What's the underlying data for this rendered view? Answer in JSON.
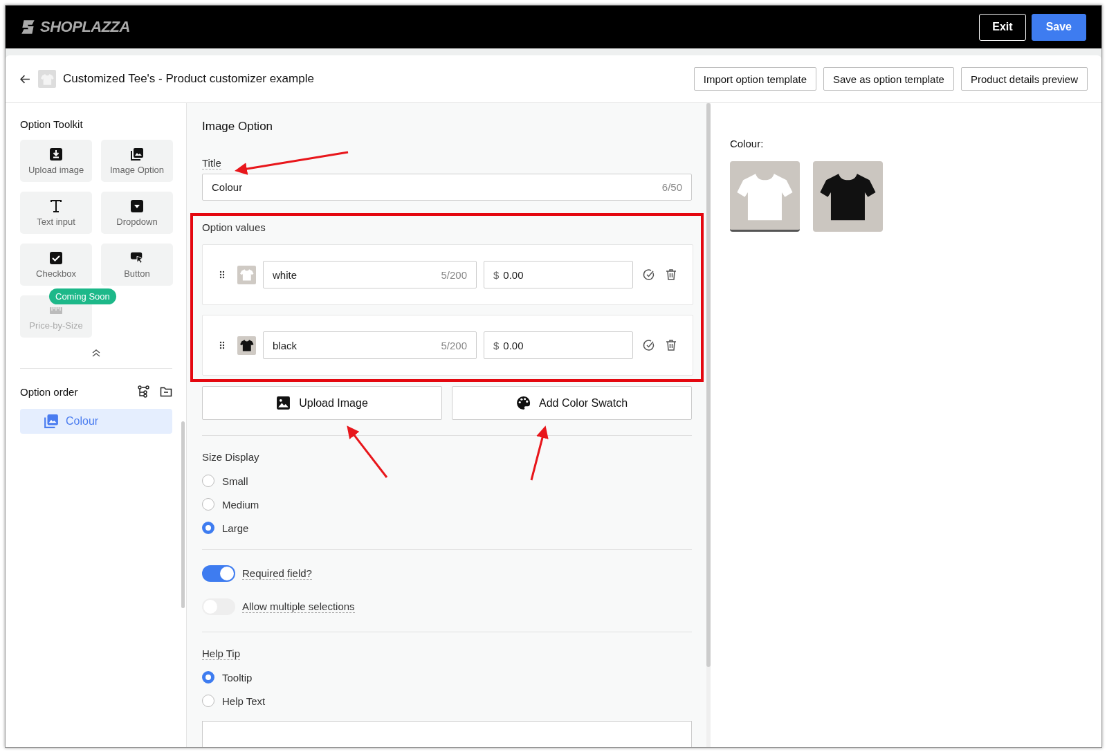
{
  "app_bar": {
    "logo": "SHOPLAZZA",
    "buttons": [
      {
        "label": "Exit",
        "kind": "secondary"
      },
      {
        "label": "Save",
        "kind": "primary"
      }
    ]
  },
  "header": {
    "title": "Customized Tee's - Product customizer example",
    "actions": [
      "Import option template",
      "Save as option template",
      "Product details preview"
    ]
  },
  "toolkit": {
    "title": "Option Toolkit",
    "items": [
      {
        "label": "Upload image",
        "kind": "upload",
        "disabled": false
      },
      {
        "label": "Image Option",
        "kind": "images",
        "disabled": false
      },
      {
        "label": "Text input",
        "kind": "text",
        "disabled": false
      },
      {
        "label": "Dropdown",
        "kind": "dropdown",
        "disabled": false
      },
      {
        "label": "Checkbox",
        "kind": "checkbox",
        "disabled": false
      },
      {
        "label": "Button",
        "kind": "pointer",
        "disabled": false
      },
      {
        "label": "Price-by-Size",
        "kind": "ruler",
        "disabled": true,
        "badge": "Coming Soon"
      }
    ]
  },
  "option_order": {
    "title": "Option order",
    "items": [
      {
        "label": "Colour",
        "selected": true
      }
    ]
  },
  "editor": {
    "heading": "Image Option",
    "title_label": "Title",
    "title_value": "Colour",
    "title_count": "6/50",
    "values_label": "Option values",
    "values": [
      {
        "name": "white",
        "count": "5/200",
        "currency": "$",
        "price": "0.00",
        "color": "#ffffff"
      },
      {
        "name": "black",
        "count": "5/200",
        "currency": "$",
        "price": "0.00",
        "color": "#111111"
      }
    ],
    "upload_button": "Upload Image",
    "swatch_button": "Add Color Swatch",
    "size_label": "Size Display",
    "sizes": [
      {
        "label": "Small",
        "selected": false
      },
      {
        "label": "Medium",
        "selected": false
      },
      {
        "label": "Large",
        "selected": true
      }
    ],
    "toggles": [
      {
        "label": "Required field?",
        "on": true
      },
      {
        "label": "Allow multiple selections",
        "on": false
      }
    ],
    "help_label": "Help Tip",
    "help_options": [
      {
        "label": "Tooltip",
        "selected": true
      },
      {
        "label": "Help Text",
        "selected": false
      }
    ]
  },
  "preview": {
    "label": "Colour:",
    "swatches": [
      {
        "color": "#ffffff",
        "selected": true
      },
      {
        "color": "#111111",
        "selected": false
      }
    ]
  }
}
